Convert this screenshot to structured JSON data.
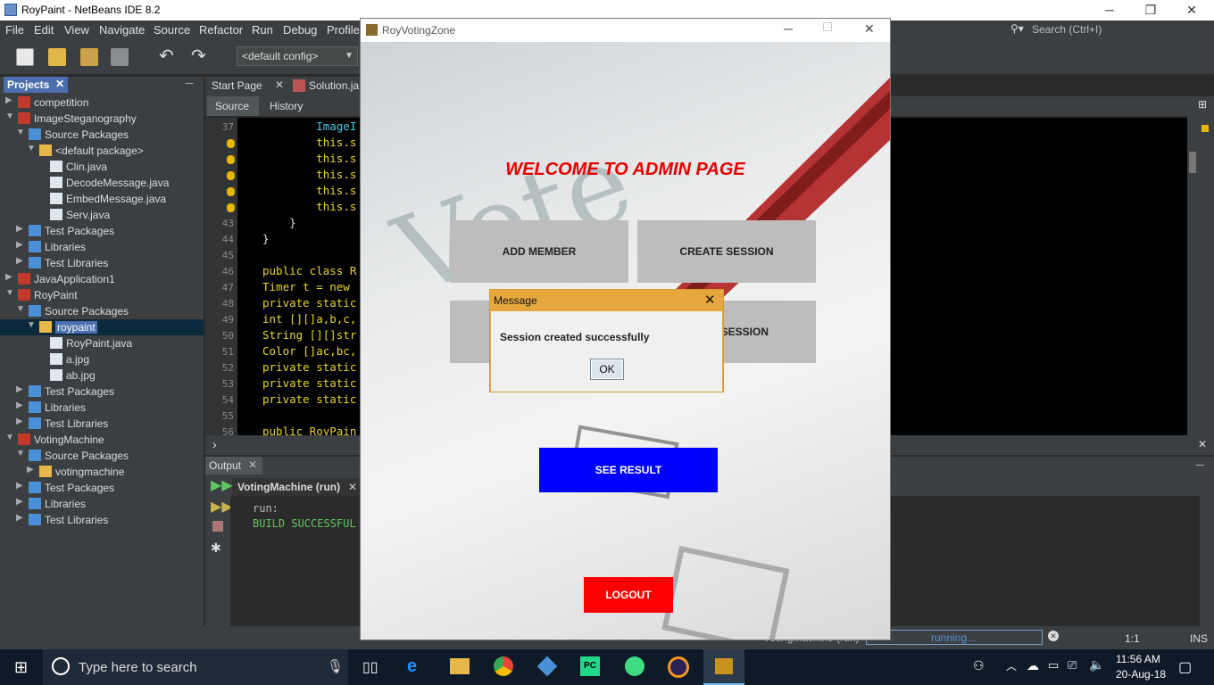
{
  "ide": {
    "title": "RoyPaint - NetBeans IDE 8.2",
    "menu": [
      "File",
      "Edit",
      "View",
      "Navigate",
      "Source",
      "Refactor",
      "Run",
      "Debug",
      "Profile"
    ],
    "search_placeholder": "Search (Ctrl+I)",
    "config": "<default config>",
    "projects_tab": "Projects",
    "tree": [
      {
        "label": "competition",
        "indent": 0
      },
      {
        "label": "ImageSteganography",
        "indent": 0
      },
      {
        "label": "Source Packages",
        "indent": 1
      },
      {
        "label": "<default package>",
        "indent": 2
      },
      {
        "label": "Clin.java",
        "indent": 3
      },
      {
        "label": "DecodeMessage.java",
        "indent": 3
      },
      {
        "label": "EmbedMessage.java",
        "indent": 3
      },
      {
        "label": "Serv.java",
        "indent": 3
      },
      {
        "label": "Test Packages",
        "indent": 1
      },
      {
        "label": "Libraries",
        "indent": 1
      },
      {
        "label": "Test Libraries",
        "indent": 1
      },
      {
        "label": "JavaApplication1",
        "indent": 0
      },
      {
        "label": "RoyPaint",
        "indent": 0
      },
      {
        "label": "Source Packages",
        "indent": 1
      },
      {
        "label": "roypaint",
        "indent": 2
      },
      {
        "label": "RoyPaint.java",
        "indent": 3
      },
      {
        "label": "a.jpg",
        "indent": 3
      },
      {
        "label": "ab.jpg",
        "indent": 3
      },
      {
        "label": "Test Packages",
        "indent": 1
      },
      {
        "label": "Libraries",
        "indent": 1
      },
      {
        "label": "Test Libraries",
        "indent": 1
      },
      {
        "label": "VotingMachine",
        "indent": 0
      },
      {
        "label": "Source Packages",
        "indent": 1
      },
      {
        "label": "votingmachine",
        "indent": 2
      },
      {
        "label": "Test Packages",
        "indent": 1
      },
      {
        "label": "Libraries",
        "indent": 1
      },
      {
        "label": "Test Libraries",
        "indent": 1
      }
    ],
    "editor_tabs": [
      "Start Page",
      "Solution.ja"
    ],
    "editor_sub": [
      "Source",
      "History"
    ],
    "line_numbers": [
      "37",
      "",
      "",
      "",
      "",
      "",
      "43",
      "44",
      "45",
      "46",
      "47",
      "48",
      "49",
      "50",
      "51",
      "52",
      "53",
      "54",
      "55",
      "56"
    ],
    "code_lines": [
      "        ImageI",
      "        this.s",
      "        this.s",
      "        this.s",
      "        this.s",
      "        this.s",
      "    }",
      "}",
      "",
      "public class R",
      "Timer t = new",
      "private static",
      "int [][]a,b,c,",
      "String [][]str",
      "Color []ac,bc,",
      "private static",
      "private static",
      "private static",
      "",
      "public RoyPain"
    ],
    "output_tab": "Output",
    "output_subtab": "VotingMachine (run)",
    "output_lines": [
      "run:",
      "BUILD SUCCESSFUL"
    ],
    "status_task": "VotingMachine (run)",
    "status_progress": "running...",
    "status_pos": "1:1",
    "status_mode": "INS"
  },
  "app": {
    "title": "RoyVotingZone",
    "welcome": "WELCOME TO ADMIN PAGE",
    "buttons": {
      "add_member": "ADD MEMBER",
      "create_session": "CREATE SESSION",
      "close_session_partial": "SESSION",
      "see_result": "SEE RESULT",
      "logout": "LOGOUT"
    },
    "colors": {
      "welcome": "#e60000",
      "see_result": "#0000ff",
      "logout": "#ff0000"
    }
  },
  "dialog": {
    "title": "Message",
    "message": "Session created successfully",
    "ok": "OK"
  },
  "taskbar": {
    "search_placeholder": "Type here to search",
    "time": "11:56 AM",
    "date": "20-Aug-18"
  }
}
